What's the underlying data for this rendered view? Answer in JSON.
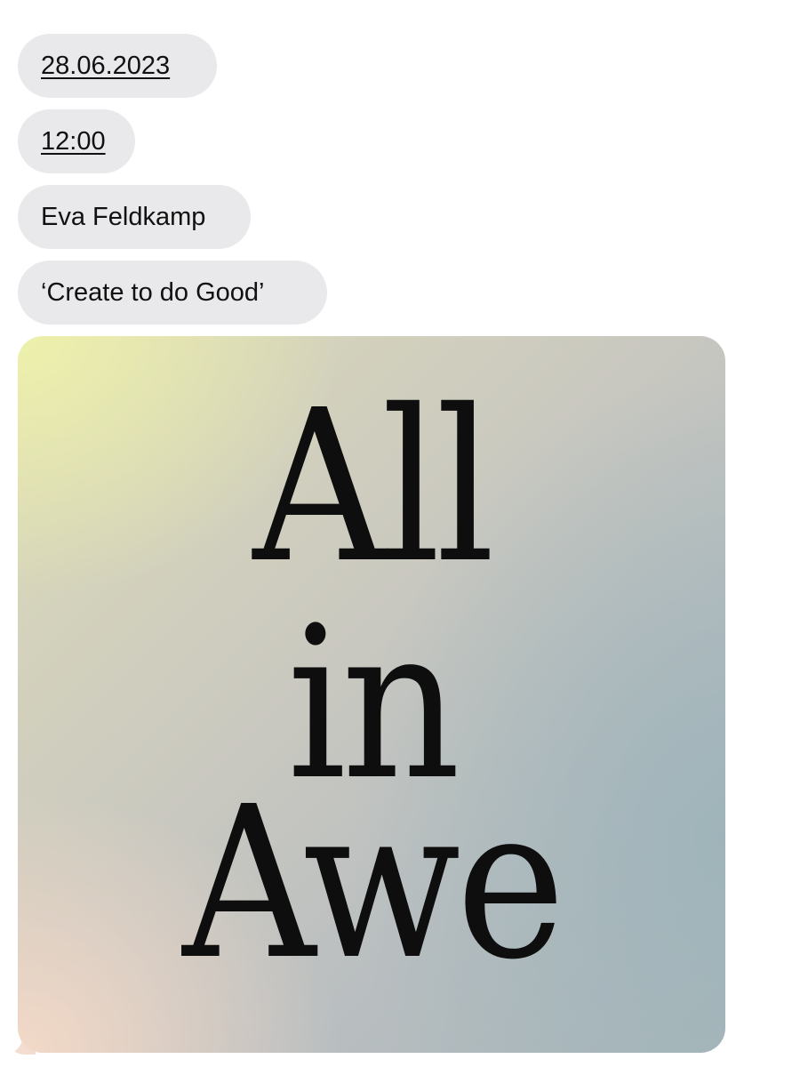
{
  "messages": {
    "date": "28.06.2023",
    "time": "12:00",
    "name": "Eva Feldkamp",
    "quote": "‘Create to do Good’"
  },
  "image": {
    "line1": "All",
    "line2": "in",
    "line3": "Awe"
  },
  "colors": {
    "bubble_background": "#e9e9eb",
    "text": "#111111",
    "gradient_top_left": "#eef2aa",
    "gradient_bottom_left": "#f6dac8",
    "gradient_right": "#9eb4ba"
  }
}
